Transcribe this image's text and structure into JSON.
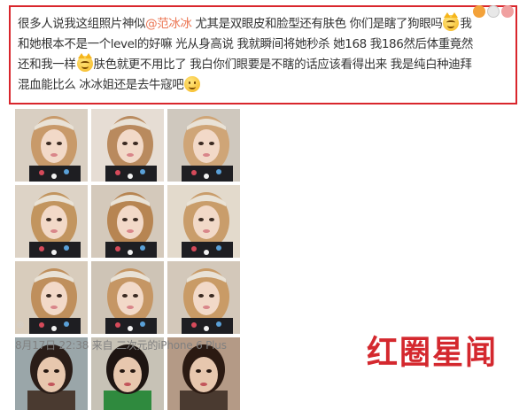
{
  "post": {
    "line1_a": "很多人说我这组照片神似",
    "mention": "@范冰冰",
    "line1_b": " 尤其是双眼皮和脸型还有肤色 你们是瞎了狗眼吗",
    "line1_c": "我",
    "line2": "和她根本不是一个level的好嘛 光从身高说 我就瞬间将她秒杀 她168 我186然后体重竟然",
    "line3_a": "还和我一样",
    "line3_b": "肤色就更不用比了 我白你们眼要是不瞎的话应该看得出来 我是纯白种迪拜",
    "line4": "混血能比么 冰冰姐还是去牛寇吧",
    "emojis": [
      "cat-emoji",
      "cat-emoji",
      "cat-emoji",
      "smile-emoji"
    ]
  },
  "photos": [
    {
      "id": "p1",
      "tone": "selfie",
      "bg": "#d9cfc2",
      "hair": "#c89a6a"
    },
    {
      "id": "p2",
      "tone": "selfie",
      "bg": "#e6ddd4",
      "hair": "#b98a5e"
    },
    {
      "id": "p3",
      "tone": "selfie",
      "bg": "#cfc8be",
      "hair": "#cfa577"
    },
    {
      "id": "p4",
      "tone": "selfie",
      "bg": "#ddd3c6",
      "hair": "#c2955f"
    },
    {
      "id": "p5",
      "tone": "selfie",
      "bg": "#d4c9bb",
      "hair": "#b78552"
    },
    {
      "id": "p6",
      "tone": "selfie",
      "bg": "#e3dacc",
      "hair": "#c99d6b"
    },
    {
      "id": "p7",
      "tone": "selfie",
      "bg": "#d8ccbc",
      "hair": "#bf8f5c"
    },
    {
      "id": "p8",
      "tone": "selfie",
      "bg": "#cec4b6",
      "hair": "#c59664"
    },
    {
      "id": "p9",
      "tone": "selfie",
      "bg": "#d3c8ba",
      "hair": "#c99b66"
    },
    {
      "id": "p10",
      "tone": "portrait",
      "bg": "#9aa6a9",
      "hair": "#2a1d18"
    },
    {
      "id": "p11",
      "tone": "portrait",
      "bg": "#c7c2b6",
      "hair": "#1e1512"
    },
    {
      "id": "p12",
      "tone": "portrait",
      "bg": "#b49a86",
      "hair": "#2b1a12"
    }
  ],
  "meta": {
    "time": "8月17日 22:38",
    "from": " 来自 ",
    "source": "二次元的iPhone 6 Plus"
  },
  "watermark": "红圈星闻",
  "colors": {
    "border": "#d9262c",
    "mention": "#eb7350",
    "watermark": "#d4282e"
  }
}
